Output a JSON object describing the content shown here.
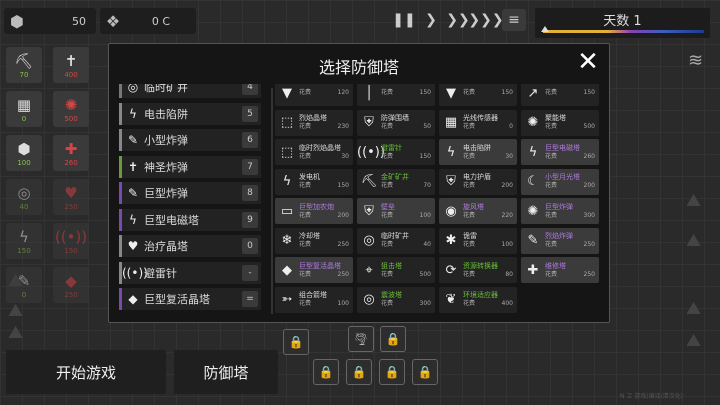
{
  "topbar": {
    "res1_value": "50",
    "res2_value": "0 C",
    "day_label": "天数 1"
  },
  "left_slots": [
    {
      "icon": "⛏",
      "cost": "70"
    },
    {
      "icon": "✝",
      "cost": "400"
    },
    {
      "icon": "▦",
      "cost": "0"
    },
    {
      "icon": "✺",
      "cost": "500"
    },
    {
      "icon": "⬢",
      "cost": "100"
    },
    {
      "icon": "✚",
      "cost": "260"
    },
    {
      "icon": "◎",
      "cost": "40"
    },
    {
      "icon": "♥",
      "cost": "250"
    },
    {
      "icon": "ϟ",
      "cost": "150"
    },
    {
      "icon": "((•))",
      "cost": "150"
    },
    {
      "icon": "✎",
      "cost": "0"
    },
    {
      "icon": "◆",
      "cost": "250"
    }
  ],
  "modal": {
    "title": "选择防御塔",
    "close": "✕"
  },
  "hotkeys": [
    {
      "icon": "◎",
      "label": "临时矿井",
      "key": "4",
      "color": "#777"
    },
    {
      "icon": "ϟ",
      "label": "电击陷阱",
      "key": "5",
      "color": "#888"
    },
    {
      "icon": "✎",
      "label": "小型炸弹",
      "key": "6",
      "color": "#888"
    },
    {
      "icon": "✝",
      "label": "神圣炸弹",
      "key": "7",
      "color": "#6b9c3a"
    },
    {
      "icon": "✎",
      "label": "巨型炸弹",
      "key": "8",
      "color": "#7a4ab0"
    },
    {
      "icon": "ϟ",
      "label": "巨型电磁塔",
      "key": "9",
      "color": "#7a4ab0"
    },
    {
      "icon": "♥",
      "label": "治疗晶塔",
      "key": "0",
      "color": "#888"
    },
    {
      "icon": "((•))",
      "label": "避雷针",
      "key": "-",
      "color": "#888"
    },
    {
      "icon": "◆",
      "label": "巨型复活晶塔",
      "key": "=",
      "color": "#7a4ab0"
    }
  ],
  "fee_label": "花费",
  "towers": [
    {
      "name": "",
      "cost": "120",
      "icon": "▼",
      "color": "#ddd"
    },
    {
      "name": "",
      "cost": "150",
      "icon": "│",
      "color": "#ddd"
    },
    {
      "name": "",
      "cost": "150",
      "icon": "▼",
      "color": "#ddd"
    },
    {
      "name": "",
      "cost": "150",
      "icon": "↗",
      "color": "#ddd"
    },
    {
      "name": "烈焰晶塔",
      "cost": "230",
      "icon": "⬚",
      "color": "#ddd"
    },
    {
      "name": "防弹围墙",
      "cost": "50",
      "icon": "⛨",
      "color": "#ddd"
    },
    {
      "name": "光线传感器",
      "cost": "0",
      "icon": "▦",
      "color": "#ddd"
    },
    {
      "name": "聚能塔",
      "cost": "500",
      "icon": "✺",
      "color": "#ddd"
    },
    {
      "name": "临时烈焰晶塔",
      "cost": "30",
      "icon": "⬚",
      "color": "#ddd"
    },
    {
      "name": "避雷针",
      "cost": "150",
      "icon": "((•))",
      "color": "#6bbf3a"
    },
    {
      "name": "电击陷阱",
      "cost": "30",
      "icon": "ϟ",
      "color": "#ddd"
    },
    {
      "name": "巨型电磁塔",
      "cost": "260",
      "icon": "ϟ",
      "color": "#b07be0"
    },
    {
      "name": "发电机",
      "cost": "150",
      "icon": "ϟ",
      "color": "#ddd"
    },
    {
      "name": "金矿矿井",
      "cost": "70",
      "icon": "⛏",
      "color": "#6bbf3a"
    },
    {
      "name": "电力护盾",
      "cost": "200",
      "icon": "⛨",
      "color": "#ddd"
    },
    {
      "name": "小型月光塔",
      "cost": "200",
      "icon": "☾",
      "color": "#b07be0"
    },
    {
      "name": "巨型加农炮",
      "cost": "200",
      "icon": "▭",
      "color": "#b07be0"
    },
    {
      "name": "壁垒",
      "cost": "100",
      "icon": "⛨",
      "color": "#b07be0"
    },
    {
      "name": "旋风塔",
      "cost": "220",
      "icon": "◉",
      "color": "#b07be0"
    },
    {
      "name": "巨型炸弹",
      "cost": "300",
      "icon": "✺",
      "color": "#b07be0"
    },
    {
      "name": "冷却塔",
      "cost": "250",
      "icon": "❄",
      "color": "#ddd"
    },
    {
      "name": "临时矿井",
      "cost": "40",
      "icon": "◎",
      "color": "#ddd"
    },
    {
      "name": "诡雷",
      "cost": "100",
      "icon": "✱",
      "color": "#ddd"
    },
    {
      "name": "烈焰炸弹",
      "cost": "250",
      "icon": "✎",
      "color": "#b07be0"
    },
    {
      "name": "巨型复活晶塔",
      "cost": "250",
      "icon": "◆",
      "color": "#b07be0"
    },
    {
      "name": "狙击塔",
      "cost": "500",
      "icon": "⌖",
      "color": "#6bbf3a"
    },
    {
      "name": "资源转换器",
      "cost": "80",
      "icon": "⟳",
      "color": "#6bbf3a"
    },
    {
      "name": "维修塔",
      "cost": "250",
      "icon": "✚",
      "color": "#b07be0"
    },
    {
      "name": "组合箭塔",
      "cost": "100",
      "icon": "➳",
      "color": "#ddd"
    },
    {
      "name": "震波塔",
      "cost": "300",
      "icon": "◎",
      "color": "#6bbf3a"
    },
    {
      "name": "环境适应器",
      "cost": "400",
      "icon": "❦",
      "color": "#6bbf3a"
    }
  ],
  "bottom": {
    "start_game": "开始游戏",
    "defense_tower": "防御塔"
  },
  "watermark": "N ヱ 游戏(编译/清汉化)"
}
